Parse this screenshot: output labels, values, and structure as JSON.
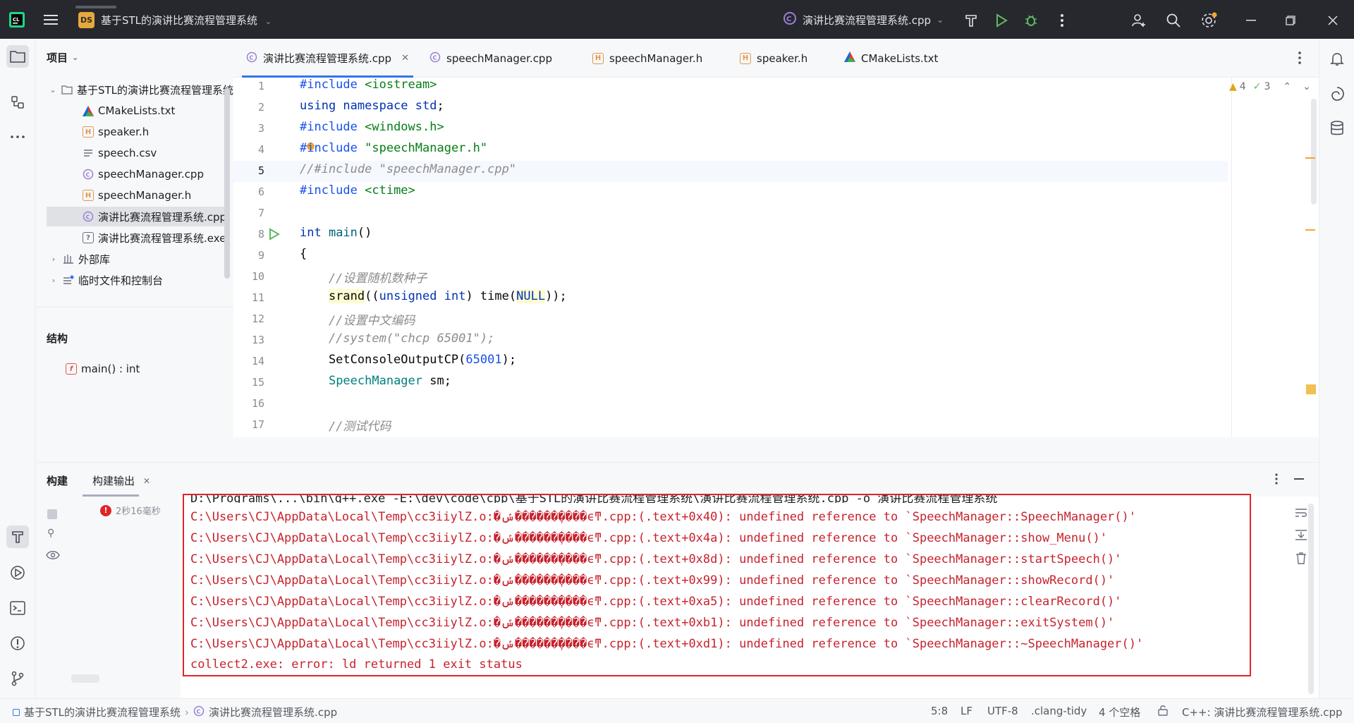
{
  "titlebar": {
    "project_badge": "DS",
    "project_name": "基于STL的演讲比赛流程管理系统",
    "run_config": "演讲比赛流程管理系统.cpp"
  },
  "project_panel": {
    "header": "项目",
    "root": "基于STL的演讲比赛流程管理系统",
    "files": [
      {
        "name": "CMakeLists.txt",
        "icon": "cmake-icon"
      },
      {
        "name": "speaker.h",
        "icon": "header-file-icon"
      },
      {
        "name": "speech.csv",
        "icon": "text-file-icon"
      },
      {
        "name": "speechManager.cpp",
        "icon": "cpp-file-icon"
      },
      {
        "name": "speechManager.h",
        "icon": "header-file-icon"
      },
      {
        "name": "演讲比赛流程管理系统.cpp",
        "icon": "cpp-file-icon"
      },
      {
        "name": "演讲比赛流程管理系统.exe",
        "icon": "unknown-file-icon"
      }
    ],
    "external_libs": "外部库",
    "scratches": "临时文件和控制台"
  },
  "structure": {
    "header": "结构",
    "item_badge": "f",
    "item": "main() : int"
  },
  "tabs": [
    {
      "label": "演讲比赛流程管理系统.cpp",
      "active": true
    },
    {
      "label": "speechManager.cpp"
    },
    {
      "label": "speechManager.h"
    },
    {
      "label": "speaker.h"
    },
    {
      "label": "CMakeLists.txt"
    }
  ],
  "editor": {
    "warnings": "4",
    "weak_warnings": "3",
    "line_numbers": [
      "1",
      "2",
      "3",
      "4",
      "5",
      "6",
      "7",
      "8",
      "9",
      "10",
      "11",
      "12",
      "13",
      "14",
      "15",
      "16",
      "17"
    ],
    "current_line": "5",
    "lines": {
      "l1a": "#include",
      "l1b": " <iostream>",
      "l2a": "using namespace",
      "l2b": " std",
      "l2c": ";",
      "l3a": "#include",
      "l3b": " <windows.h>",
      "l4a": "#include",
      "l4b": " \"speechManager.h\"",
      "l5": "//#include \"speechManager.cpp\"",
      "l6a": "#include",
      "l6b": " <ctime>",
      "l8a": "int",
      "l8b": " main",
      "l8c": "()",
      "l9": "{",
      "l10": "    //设置随机数种子",
      "l11a": "    ",
      "l11b": "srand",
      "l11c": "((",
      "l11d": "unsigned int",
      "l11e": ") time(",
      "l11f": "NULL",
      "l11g": "));",
      "l12": "    //设置中文编码",
      "l13": "    //system(\"chcp 65001\");",
      "l14a": "    SetConsoleOutputCP(",
      "l14b": "65001",
      "l14c": ");",
      "l15a": "    ",
      "l15b": "SpeechManager",
      "l15c": " sm;",
      "l17": "    //测试代码"
    }
  },
  "build": {
    "tab_build": "构建",
    "tab_output": "构建输出",
    "time": "2秒16毫秒",
    "partial_line": "D:\\Programs\\...\\bin\\g++.exe -E:\\dev\\code\\cpp\\基于STL的演讲比赛流程管理系统\\演讲比赛流程管理系统.cpp -o 演讲比赛流程管理系统",
    "lines": [
      "C:\\Users\\CJ\\AppData\\Local\\Temp\\cc3iiylZ.o:�ݽ�������̹���ϵͳ.cpp:(.text+0x40): undefined reference to `SpeechManager::SpeechManager()'",
      "C:\\Users\\CJ\\AppData\\Local\\Temp\\cc3iiylZ.o:�ݽ�������̹���ϵͳ.cpp:(.text+0x4a): undefined reference to `SpeechManager::show_Menu()'",
      "C:\\Users\\CJ\\AppData\\Local\\Temp\\cc3iiylZ.o:�ݽ�������̹���ϵͳ.cpp:(.text+0x8d): undefined reference to `SpeechManager::startSpeech()'",
      "C:\\Users\\CJ\\AppData\\Local\\Temp\\cc3iiylZ.o:�ݽ�������̹���ϵͳ.cpp:(.text+0x99): undefined reference to `SpeechManager::showRecord()'",
      "C:\\Users\\CJ\\AppData\\Local\\Temp\\cc3iiylZ.o:�ݽ�������̹���ϵͳ.cpp:(.text+0xa5): undefined reference to `SpeechManager::clearRecord()'",
      "C:\\Users\\CJ\\AppData\\Local\\Temp\\cc3iiylZ.o:�ݽ�������̹���ϵͳ.cpp:(.text+0xb1): undefined reference to `SpeechManager::exitSystem()'",
      "C:\\Users\\CJ\\AppData\\Local\\Temp\\cc3iiylZ.o:�ݽ�������̹���ϵͳ.cpp:(.text+0xd1): undefined reference to `SpeechManager::~SpeechManager()'",
      "collect2.exe: error: ld returned 1 exit status"
    ]
  },
  "statusbar": {
    "project": "基于STL的演讲比赛流程管理系统",
    "file": "演讲比赛流程管理系统.cpp",
    "position": "5:8",
    "line_sep": "LF",
    "encoding": "UTF-8",
    "linter": ".clang-tidy",
    "indent": "4 个空格",
    "language": "C++: 演讲比赛流程管理系统.cpp"
  },
  "colors": {
    "accent": "#3574f0",
    "error": "#e0252a",
    "titlebar": "#27282e"
  }
}
